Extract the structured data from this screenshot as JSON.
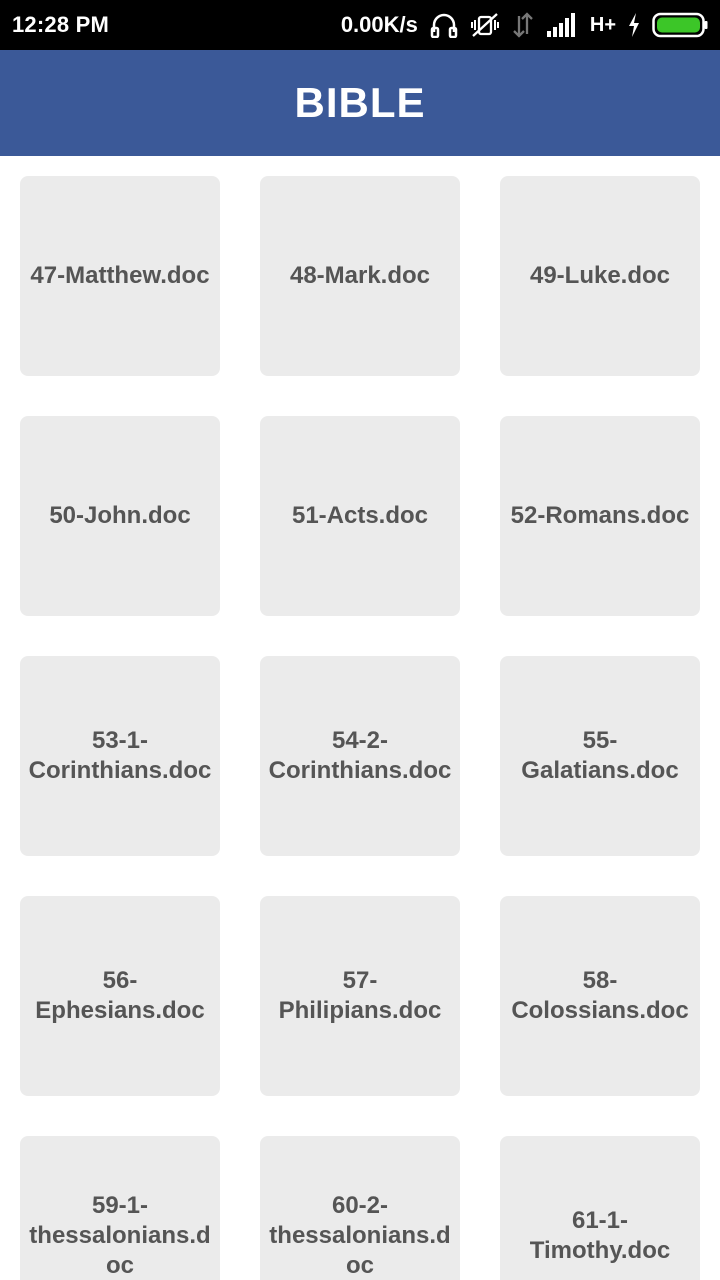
{
  "status_bar": {
    "time": "12:28 PM",
    "speed": "0.00K/s",
    "network": "H+",
    "battery_color": "#3cc628",
    "icons": [
      "headphones-icon",
      "mute-vibrate-icon",
      "data-arrows-icon",
      "signal-icon",
      "charging-icon",
      "battery-icon"
    ]
  },
  "app_bar": {
    "title": "BIBLE",
    "color": "#3b5998"
  },
  "files": [
    {
      "line1": "47-Matthew.doc",
      "line2": "",
      "line3": ""
    },
    {
      "line1": "48-Mark.doc",
      "line2": "",
      "line3": ""
    },
    {
      "line1": "49-Luke.doc",
      "line2": "",
      "line3": ""
    },
    {
      "line1": "50-John.doc",
      "line2": "",
      "line3": ""
    },
    {
      "line1": "51-Acts.doc",
      "line2": "",
      "line3": ""
    },
    {
      "line1": "52-Romans.doc",
      "line2": "",
      "line3": ""
    },
    {
      "line1": "53-1-",
      "line2": "Corinthians.doc",
      "line3": ""
    },
    {
      "line1": "54-2-",
      "line2": "Corinthians.doc",
      "line3": ""
    },
    {
      "line1": "55-",
      "line2": "Galatians.doc",
      "line3": ""
    },
    {
      "line1": "56-",
      "line2": "Ephesians.doc",
      "line3": ""
    },
    {
      "line1": "57-",
      "line2": "Philipians.doc",
      "line3": ""
    },
    {
      "line1": "58-",
      "line2": "Colossians.doc",
      "line3": ""
    },
    {
      "line1": "59-1-",
      "line2": "thessalonians.d",
      "line3": "oc"
    },
    {
      "line1": "60-2-",
      "line2": "thessalonians.d",
      "line3": "oc"
    },
    {
      "line1": "61-1-",
      "line2": "Timothy.doc",
      "line3": ""
    }
  ]
}
